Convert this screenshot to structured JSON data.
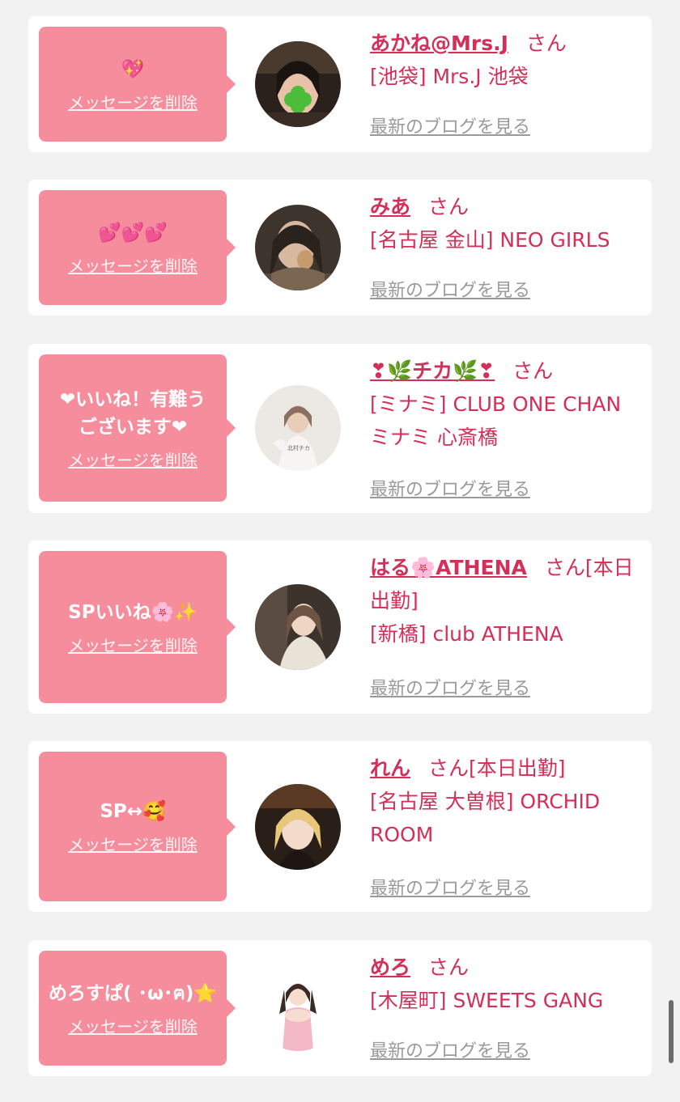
{
  "items": [
    {
      "message": "💖",
      "delete_label": "メッセージを削除",
      "name": "あかね@Mrs.J",
      "suffix": "さん",
      "extra": "",
      "shop": "[池袋] Mrs.J 池袋",
      "blog_label": "最新のブログを見る"
    },
    {
      "message": "💕💕💕",
      "delete_label": "メッセージを削除",
      "name": "みあ",
      "suffix": "さん",
      "extra": "",
      "shop": "[名古屋 金山] NEO GIRLS",
      "blog_label": "最新のブログを見る"
    },
    {
      "message": "❤いいね！有難うございます❤",
      "delete_label": "メッセージを削除",
      "name": "❣🌿チカ🌿❣",
      "suffix": "さん",
      "extra": "",
      "shop": "[ミナミ] CLUB ONE CHAN ミナミ 心斎橋",
      "blog_label": "最新のブログを見る"
    },
    {
      "message": "SPいいね🌸✨",
      "delete_label": "メッセージを削除",
      "name": "はる🌸ATHENA",
      "suffix": "さん",
      "extra": "[本日出勤]",
      "shop": "[新橋] club ATHENA",
      "blog_label": "最新のブログを見る"
    },
    {
      "message": "SP↔🥰",
      "delete_label": "メッセージを削除",
      "name": "れん",
      "suffix": "さん",
      "extra": "[本日出勤]",
      "shop": "[名古屋 大曽根] ORCHID ROOM",
      "blog_label": "最新のブログを見る"
    },
    {
      "message": "めろすぱ( ･ω･ฅ)⭐",
      "delete_label": "メッセージを削除",
      "name": "めろ",
      "suffix": "さん",
      "extra": "",
      "shop": "[木屋町] SWEETS GANG",
      "blog_label": "最新のブログを見る"
    }
  ],
  "colors": {
    "accent": "#d42f58",
    "bubble": "#f68d9c",
    "background": "#f2f2f2",
    "link_gray": "#9a9a9a"
  }
}
